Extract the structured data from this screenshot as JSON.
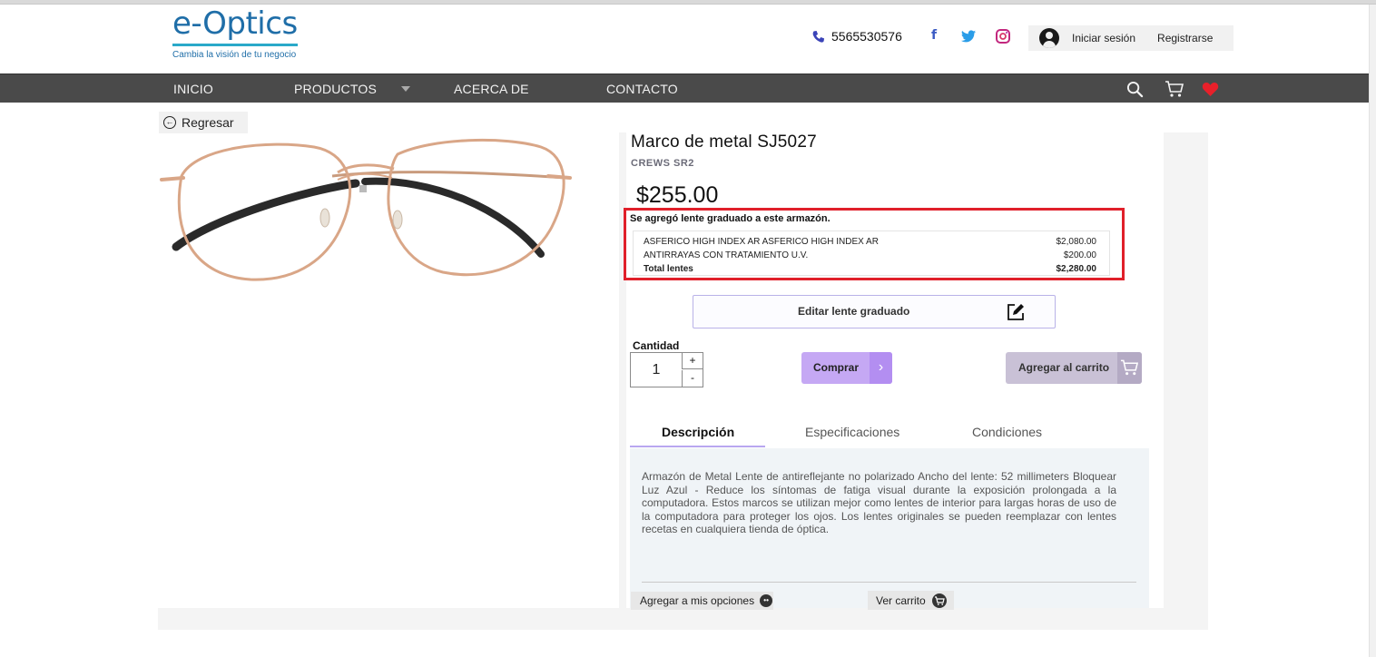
{
  "header": {
    "logo_text": "e-Optics",
    "logo_tagline": "Cambia la visión de tu negocio",
    "phone": "5565530576",
    "social": {
      "facebook": "f",
      "twitter": "twitter-bird",
      "instagram": "instagram"
    },
    "login_label": "Iniciar sesión",
    "register_label": "Registrarse"
  },
  "nav": {
    "items": [
      "INICIO",
      "PRODUCTOS",
      "ACERCA DE",
      "CONTACTO"
    ],
    "icons": [
      "search-icon",
      "cart-icon",
      "heart-icon"
    ],
    "heart_color": "#e8202a"
  },
  "back_label": "Regresar",
  "product": {
    "title": "Marco de metal SJ5027",
    "brand": "CREWS SR2",
    "price": "$255.00"
  },
  "lens": {
    "note": "Se agregó lente graduado a este armazón.",
    "items": [
      {
        "name": "ASFERICO HIGH INDEX AR ASFERICO HIGH INDEX AR",
        "price": "$2,080.00"
      },
      {
        "name": "ANTIRRAYAS CON TRATAMIENTO U.V.",
        "price": "$200.00"
      }
    ],
    "total_label": "Total lentes",
    "total_price": "$2,280.00",
    "highlight_color": "#e0202a"
  },
  "edit_label": "Editar lente graduado",
  "quantity": {
    "label": "Cantidad",
    "value": "1",
    "plus": "+",
    "minus": "-"
  },
  "buy_label": "Comprar",
  "add_cart_label": "Agregar al carrito",
  "tabs": [
    "Descripción",
    "Especificaciones",
    "Condiciones"
  ],
  "description": "Armazón de Metal Lente de antireflejante no polarizado Ancho del lente: 52 millimeters Bloquear Luz Azul - Reduce los síntomas de fatiga visual durante la exposición prolongada a la computadora. Estos marcos se utilizan mejor como lentes de interior para largas horas de uso de la computadora para proteger los ojos. Los lentes originales se pueden reemplazar con lentes recetas en cualquiera tienda de óptica.",
  "bottom": {
    "options_label": "Agregar a mis opciones",
    "view_cart_label": "Ver carrito"
  }
}
